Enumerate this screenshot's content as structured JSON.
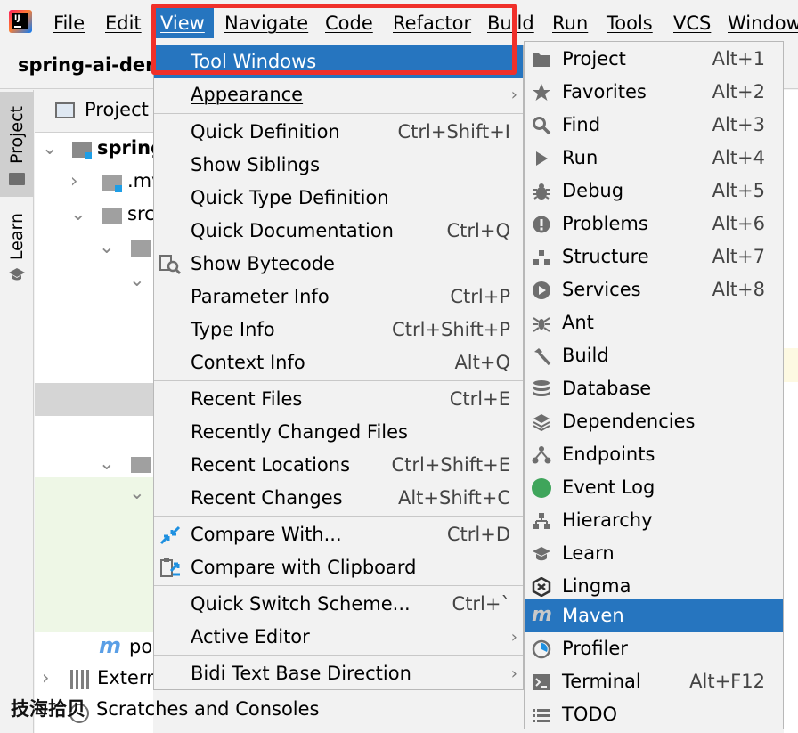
{
  "menubar": {
    "items": [
      "File",
      "Edit",
      "View",
      "Navigate",
      "Code",
      "Refactor",
      "Build",
      "Run",
      "Tools",
      "VCS",
      "Window"
    ],
    "active": "View"
  },
  "title": {
    "project_name": "spring-ai-dem"
  },
  "left_tabs": [
    "Project",
    "Learn"
  ],
  "project_panel": {
    "header": "Project",
    "tree": [
      "spring",
      ".mv",
      "src",
      "po",
      "Extern",
      "Scratches and Consoles"
    ]
  },
  "view_menu": {
    "items": [
      {
        "label": "Tool Windows",
        "shortcut": "",
        "submenu": false
      },
      {
        "label": "Appearance",
        "shortcut": "",
        "submenu": true
      },
      {
        "label": "Quick Definition",
        "shortcut": "Ctrl+Shift+I"
      },
      {
        "label": "Show Siblings",
        "shortcut": ""
      },
      {
        "label": "Quick Type Definition",
        "shortcut": ""
      },
      {
        "label": "Quick Documentation",
        "shortcut": "Ctrl+Q"
      },
      {
        "label": "Show Bytecode",
        "shortcut": ""
      },
      {
        "label": "Parameter Info",
        "shortcut": "Ctrl+P"
      },
      {
        "label": "Type Info",
        "shortcut": "Ctrl+Shift+P"
      },
      {
        "label": "Context Info",
        "shortcut": "Alt+Q"
      },
      {
        "label": "Recent Files",
        "shortcut": "Ctrl+E"
      },
      {
        "label": "Recently Changed Files",
        "shortcut": ""
      },
      {
        "label": "Recent Locations",
        "shortcut": "Ctrl+Shift+E"
      },
      {
        "label": "Recent Changes",
        "shortcut": "Alt+Shift+C"
      },
      {
        "label": "Compare With...",
        "shortcut": "Ctrl+D"
      },
      {
        "label": "Compare with Clipboard",
        "shortcut": ""
      },
      {
        "label": "Quick Switch Scheme...",
        "shortcut": "Ctrl+`"
      },
      {
        "label": "Active Editor",
        "shortcut": "",
        "submenu": true
      },
      {
        "label": "Bidi Text Base Direction",
        "shortcut": "",
        "submenu": true
      }
    ]
  },
  "tool_windows": {
    "items": [
      {
        "label": "Project",
        "shortcut": "Alt+1",
        "icon": "folder-icon"
      },
      {
        "label": "Favorites",
        "shortcut": "Alt+2",
        "icon": "star-icon"
      },
      {
        "label": "Find",
        "shortcut": "Alt+3",
        "icon": "search-icon"
      },
      {
        "label": "Run",
        "shortcut": "Alt+4",
        "icon": "play-icon"
      },
      {
        "label": "Debug",
        "shortcut": "Alt+5",
        "icon": "bug-icon"
      },
      {
        "label": "Problems",
        "shortcut": "Alt+6",
        "icon": "warning-icon"
      },
      {
        "label": "Structure",
        "shortcut": "Alt+7",
        "icon": "structure-icon"
      },
      {
        "label": "Services",
        "shortcut": "Alt+8",
        "icon": "services-icon"
      },
      {
        "label": "Ant",
        "shortcut": "",
        "icon": "ant-icon"
      },
      {
        "label": "Build",
        "shortcut": "",
        "icon": "hammer-icon"
      },
      {
        "label": "Database",
        "shortcut": "",
        "icon": "database-icon"
      },
      {
        "label": "Dependencies",
        "shortcut": "",
        "icon": "layers-icon"
      },
      {
        "label": "Endpoints",
        "shortcut": "",
        "icon": "endpoints-icon"
      },
      {
        "label": "Event Log",
        "shortcut": "",
        "icon": "event-log-icon"
      },
      {
        "label": "Hierarchy",
        "shortcut": "",
        "icon": "hierarchy-icon"
      },
      {
        "label": "Learn",
        "shortcut": "",
        "icon": "learn-icon"
      },
      {
        "label": "Lingma",
        "shortcut": "",
        "icon": "lingma-icon"
      },
      {
        "label": "Maven",
        "shortcut": "",
        "icon": "maven-icon"
      },
      {
        "label": "Profiler",
        "shortcut": "",
        "icon": "profiler-icon"
      },
      {
        "label": "Terminal",
        "shortcut": "Alt+F12",
        "icon": "terminal-icon"
      },
      {
        "label": "TODO",
        "shortcut": "",
        "icon": "todo-icon"
      }
    ],
    "highlighted": "Maven"
  },
  "watermark": "技海拾贝",
  "colors": {
    "highlight": "#2675bf",
    "annotation": "#f0302a",
    "event_log": "#3fa55b"
  }
}
